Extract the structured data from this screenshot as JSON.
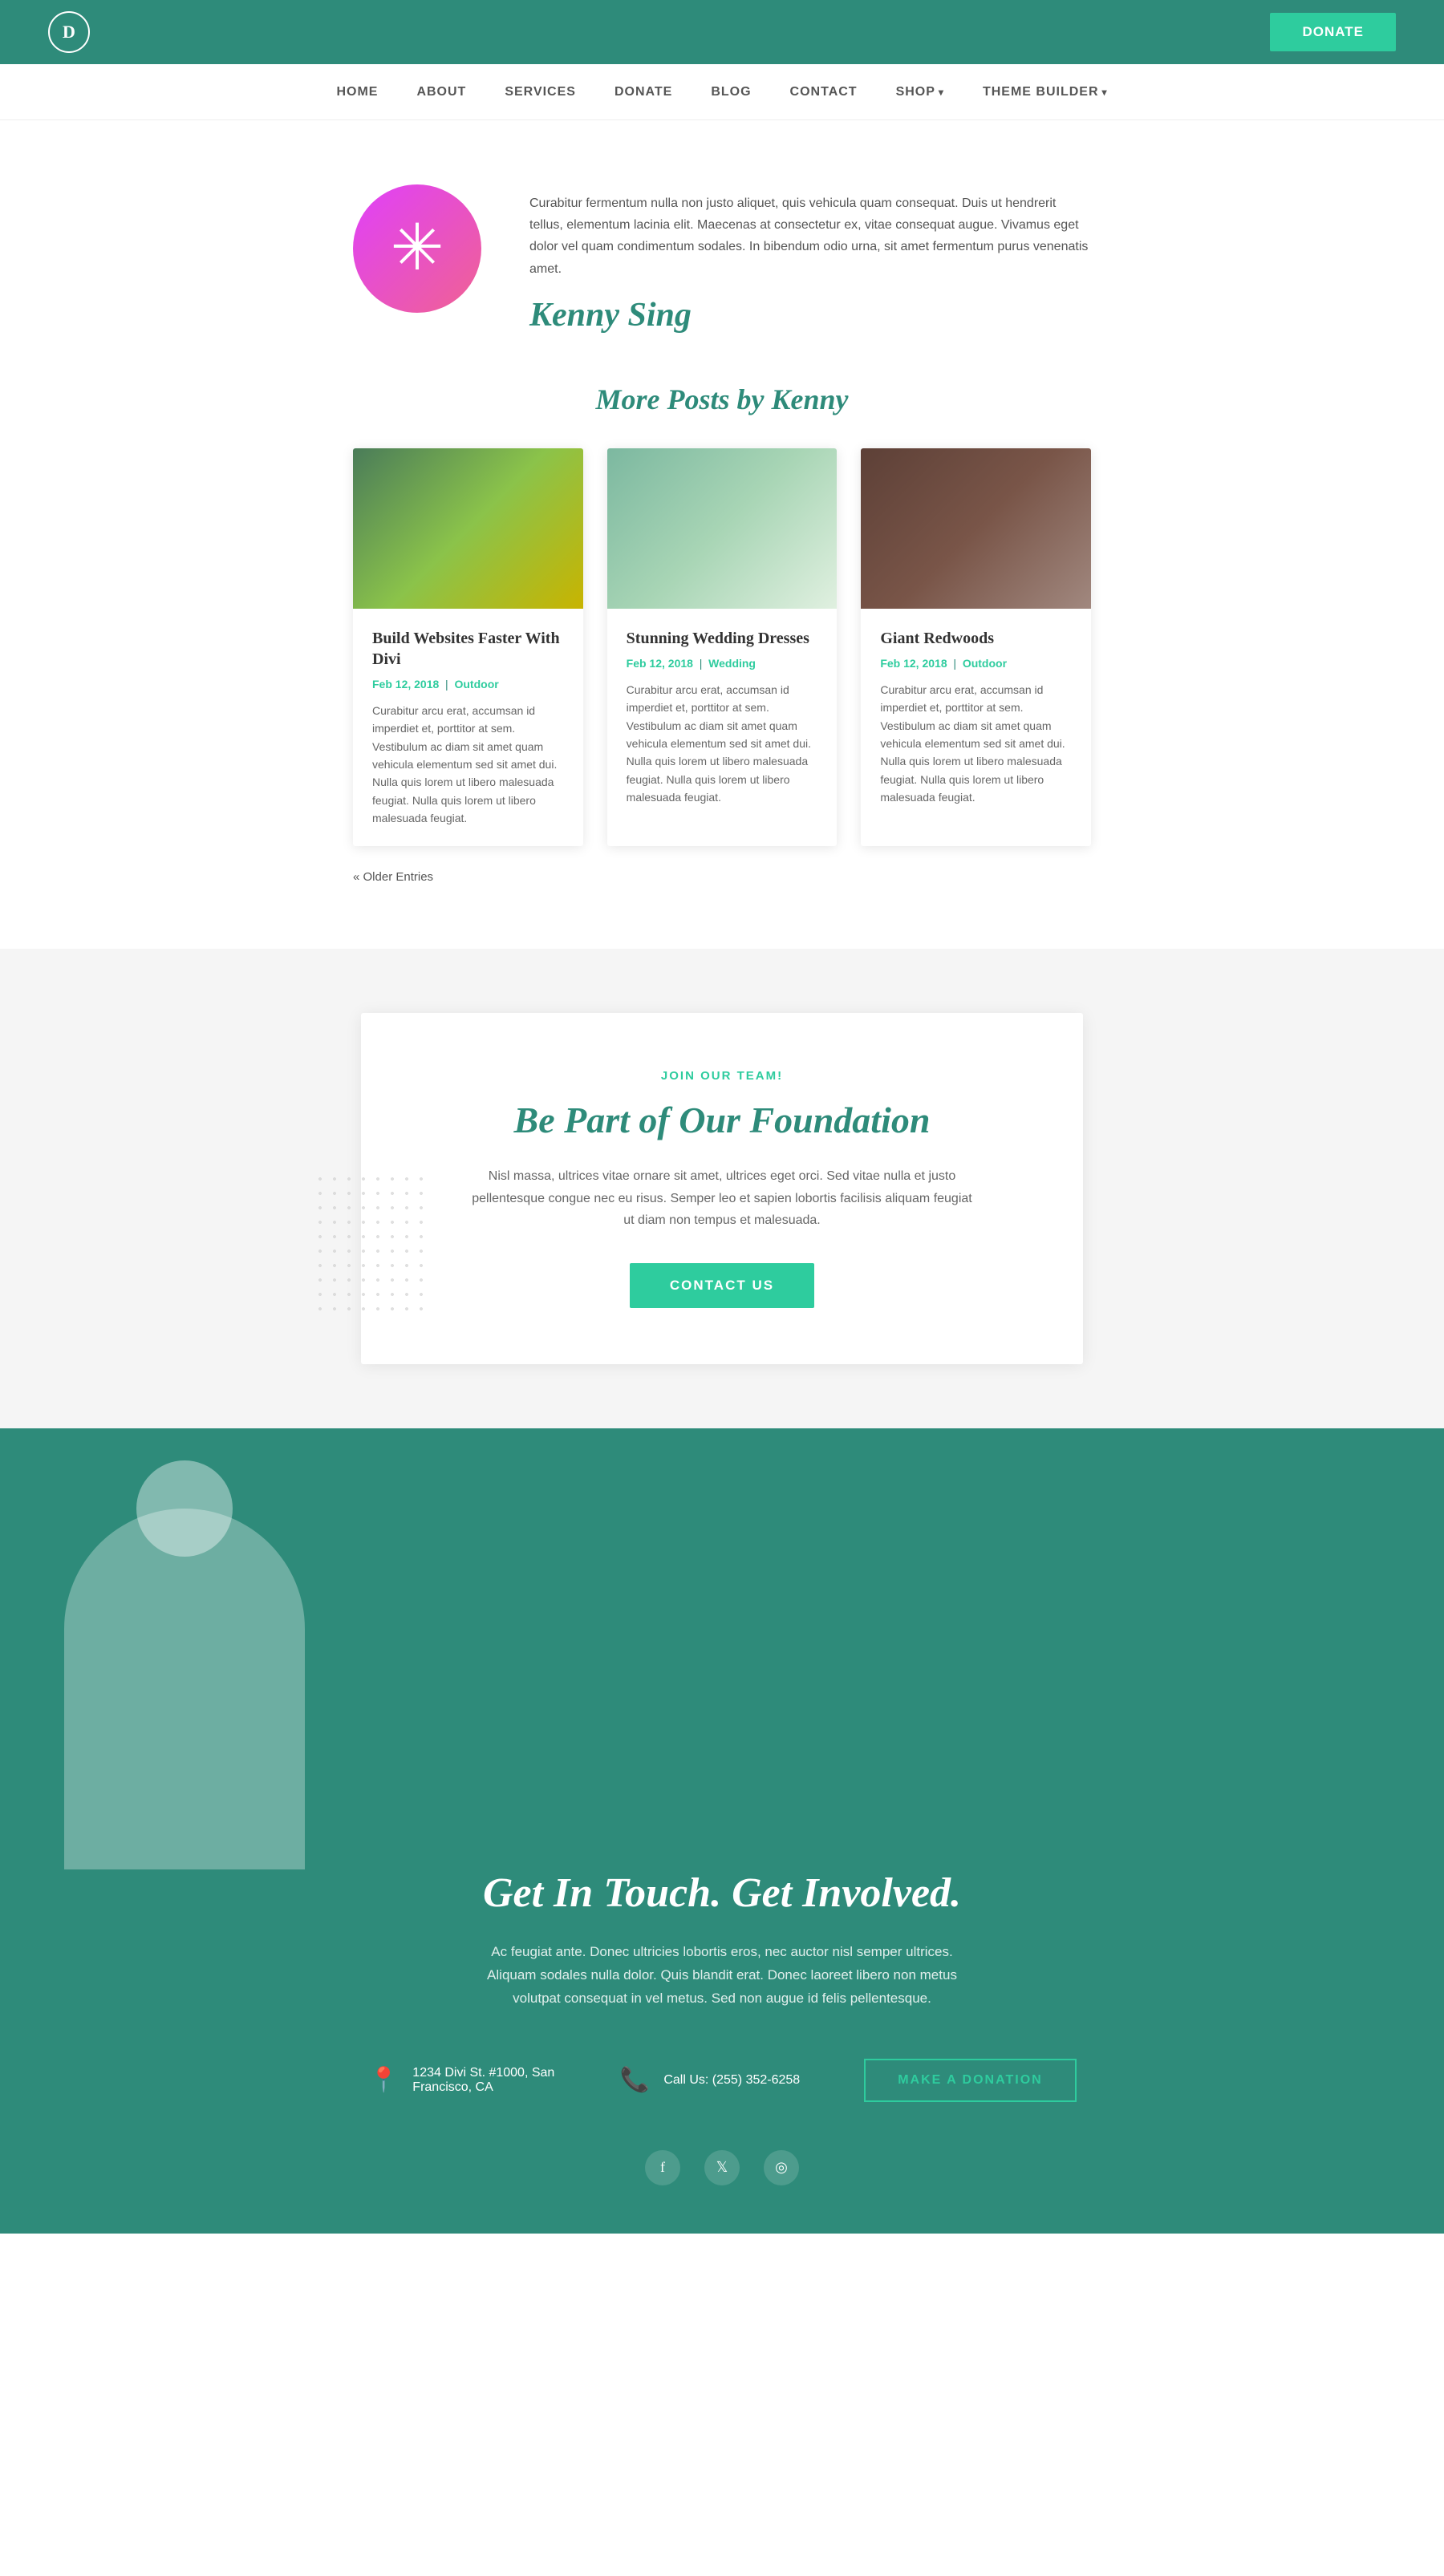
{
  "topNav": {
    "logoLetter": "D",
    "donateBtnLabel": "DONATE"
  },
  "mainNav": {
    "items": [
      {
        "label": "HOME",
        "hasArrow": false
      },
      {
        "label": "ABOUT",
        "hasArrow": false
      },
      {
        "label": "SERVICES",
        "hasArrow": false
      },
      {
        "label": "DONATE",
        "hasArrow": false
      },
      {
        "label": "BLOG",
        "hasArrow": false
      },
      {
        "label": "CONTACT",
        "hasArrow": false
      },
      {
        "label": "SHOP",
        "hasArrow": true
      },
      {
        "label": "THEME BUILDER",
        "hasArrow": true
      }
    ]
  },
  "author": {
    "name": "Kenny Sing",
    "bio": "Curabitur fermentum nulla non justo aliquet, quis vehicula quam consequat. Duis ut hendrerit tellus, elementum lacinia elit. Maecenas at consectetur ex, vitae consequat augue. Vivamus eget dolor vel quam condimentum sodales. In bibendum odio urna, sit amet fermentum purus venenatis amet."
  },
  "morePosts": {
    "title": "More Posts by Kenny",
    "posts": [
      {
        "title": "Build Websites Faster With Divi",
        "date": "Feb 12, 2018",
        "category": "Outdoor",
        "text": "Curabitur arcu erat, accumsan id imperdiet et, porttitor at sem. Vestibulum ac diam sit amet quam vehicula elementum sed sit amet dui. Nulla quis lorem ut libero malesuada feugiat. Nulla quis lorem ut libero malesuada feugiat.",
        "imgClass": "post-img-1"
      },
      {
        "title": "Stunning Wedding Dresses",
        "date": "Feb 12, 2018",
        "category": "Wedding",
        "text": "Curabitur arcu erat, accumsan id imperdiet et, porttitor at sem. Vestibulum ac diam sit amet quam vehicula elementum sed sit amet dui. Nulla quis lorem ut libero malesuada feugiat. Nulla quis lorem ut libero malesuada feugiat.",
        "imgClass": "post-img-2"
      },
      {
        "title": "Giant Redwoods",
        "date": "Feb 12, 2018",
        "category": "Outdoor",
        "text": "Curabitur arcu erat, accumsan id imperdiet et, porttitor at sem. Vestibulum ac diam sit amet quam vehicula elementum sed sit amet dui. Nulla quis lorem ut libero malesuada feugiat. Nulla quis lorem ut libero malesuada feugiat.",
        "imgClass": "post-img-3"
      }
    ],
    "olderEntries": "« Older Entries"
  },
  "joinSection": {
    "label": "JOIN OUR TEAM!",
    "title": "Be Part of Our Foundation",
    "text": "Nisl massa, ultrices vitae ornare sit amet, ultrices eget orci. Sed vitae nulla et justo pellentesque congue nec eu risus. Semper leo et sapien lobortis facilisis aliquam feugiat ut diam non tempus et malesuada.",
    "btnLabel": "CONTACT US"
  },
  "footer": {
    "title": "Get In Touch. Get Involved.",
    "desc": "Ac feugiat ante. Donec ultricies lobortis eros, nec auctor nisl semper ultrices. Aliquam sodales nulla dolor. Quis blandit erat. Donec laoreet libero non metus volutpat consequat in vel metus. Sed non augue id felis pellentesque.",
    "address": {
      "icon": "📍",
      "line1": "1234 Divi St. #1000, San",
      "line2": "Francisco, CA"
    },
    "phone": {
      "icon": "📞",
      "text": "Call Us: (255) 352-6258"
    },
    "donationBtn": "MAKE A DONATION",
    "social": [
      {
        "name": "facebook",
        "icon": "f"
      },
      {
        "name": "twitter",
        "icon": "𝕏"
      },
      {
        "name": "instagram",
        "icon": "◎"
      }
    ]
  }
}
